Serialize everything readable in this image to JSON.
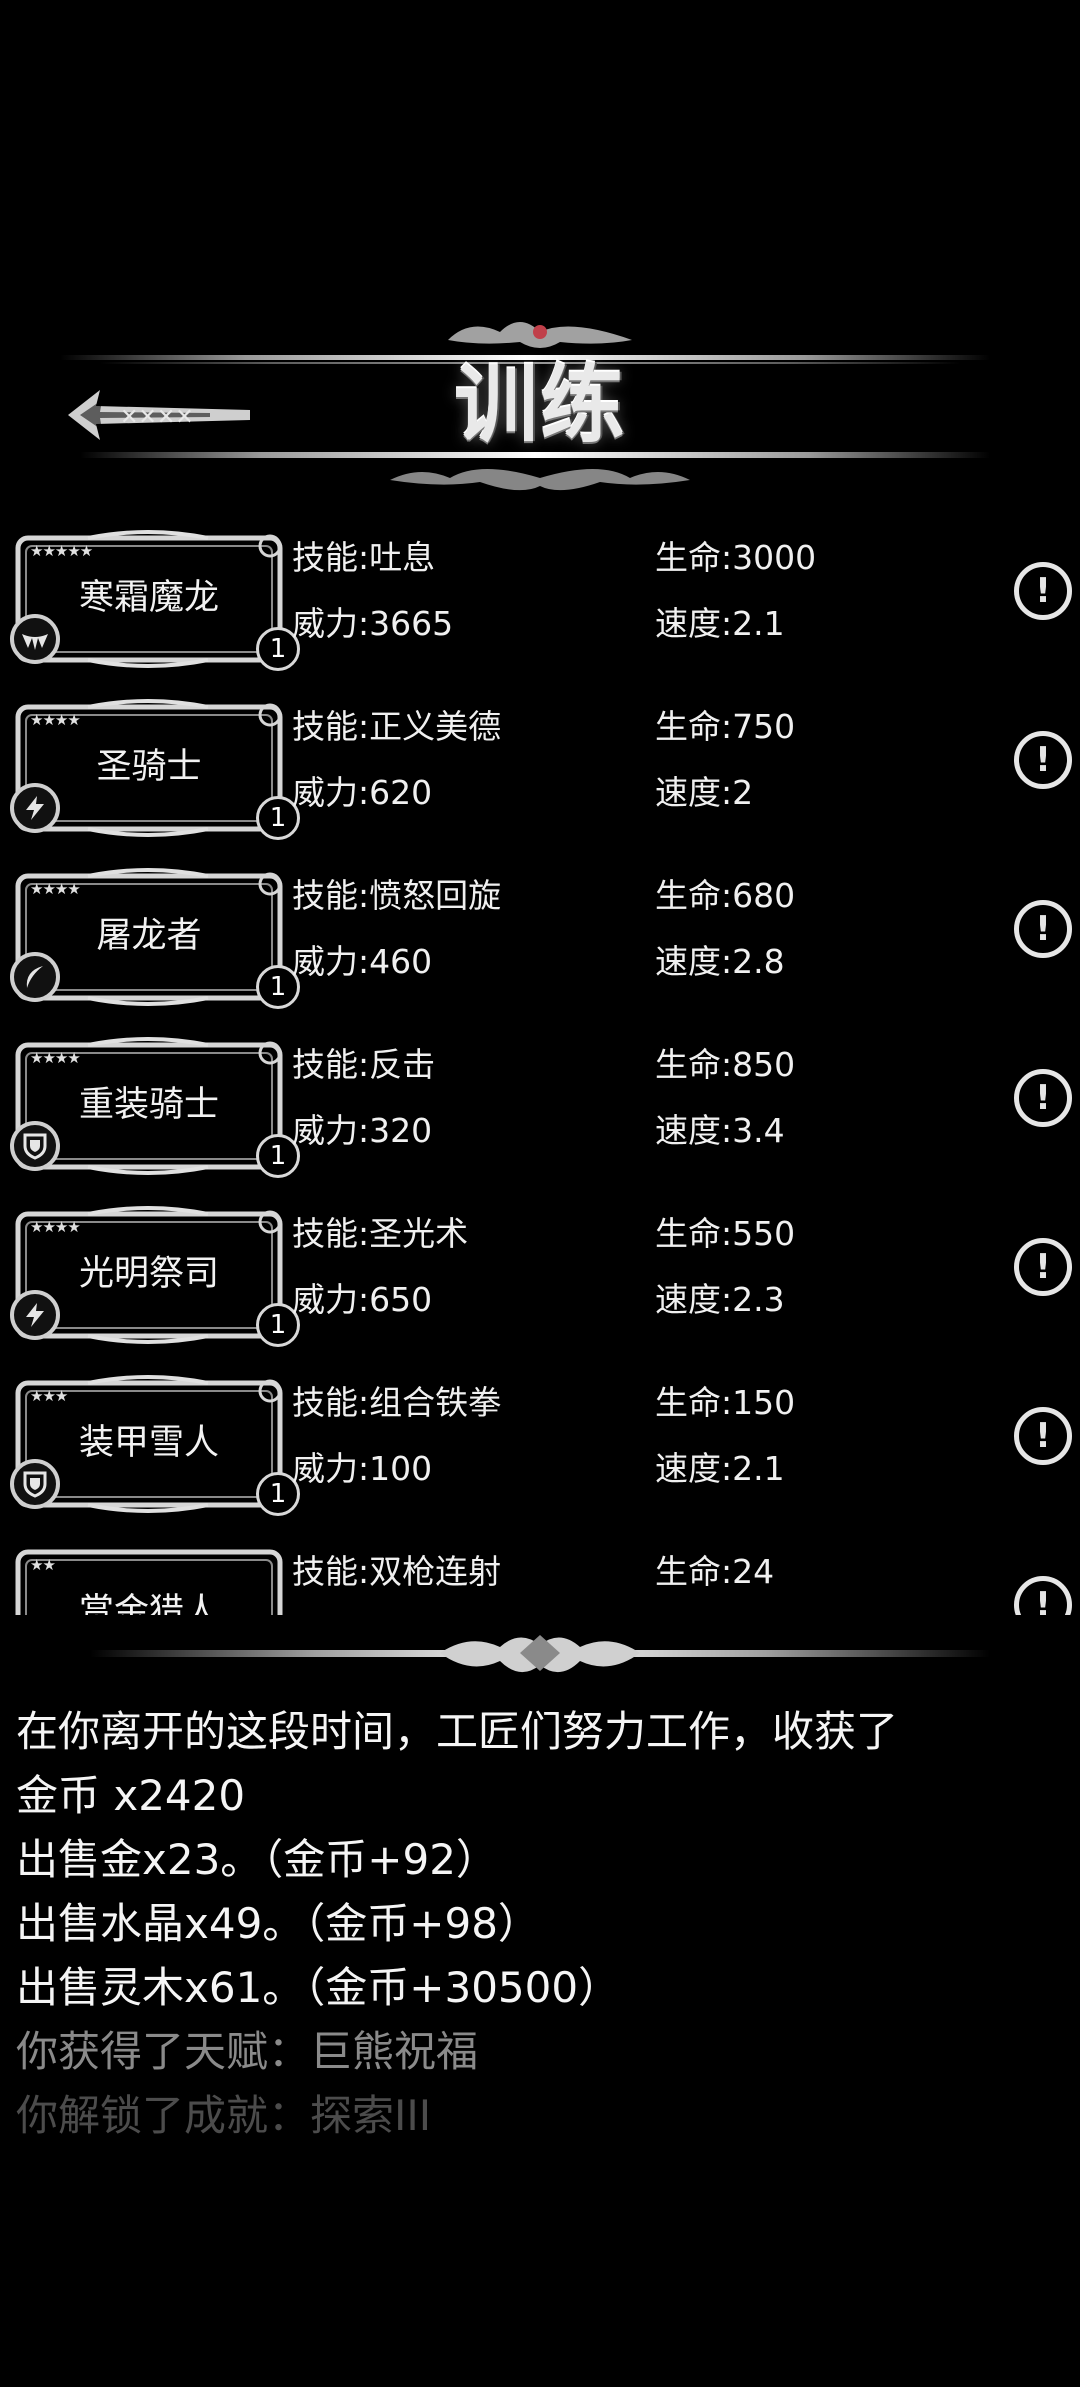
{
  "header": {
    "title": "训练",
    "back_icon": "ornate-back-arrow-icon"
  },
  "heroes": [
    {
      "stars": "★★★★★",
      "name": "寒霜魔龙",
      "class_icon": "dragon-wing-icon",
      "level": "1",
      "skill": "技能:吐息",
      "power": "威力:3665",
      "hp": "生命:3000",
      "speed": "速度:2.1"
    },
    {
      "stars": "★★★★",
      "name": "圣骑士",
      "class_icon": "lightning-icon",
      "level": "1",
      "skill": "技能:正义美德",
      "power": "威力:620",
      "hp": "生命:750",
      "speed": "速度:2"
    },
    {
      "stars": "★★★★",
      "name": "屠龙者",
      "class_icon": "crescent-blade-icon",
      "level": "1",
      "skill": "技能:愤怒回旋",
      "power": "威力:460",
      "hp": "生命:680",
      "speed": "速度:2.8"
    },
    {
      "stars": "★★★★",
      "name": "重装骑士",
      "class_icon": "shield-icon",
      "level": "1",
      "skill": "技能:反击",
      "power": "威力:320",
      "hp": "生命:850",
      "speed": "速度:3.4"
    },
    {
      "stars": "★★★★",
      "name": "光明祭司",
      "class_icon": "lightning-icon",
      "level": "1",
      "skill": "技能:圣光术",
      "power": "威力:650",
      "hp": "生命:550",
      "speed": "速度:2.3"
    },
    {
      "stars": "★★★",
      "name": "装甲雪人",
      "class_icon": "shield-icon",
      "level": "1",
      "skill": "技能:组合铁拳",
      "power": "威力:100",
      "hp": "生命:150",
      "speed": "速度:2.1"
    },
    {
      "stars": "★★",
      "name": "赏金猎人",
      "class_icon": "",
      "level": "",
      "skill": "技能:双枪连射",
      "power": "",
      "hp": "生命:24",
      "speed": ""
    }
  ],
  "info_icon": "exclamation-info-icon",
  "log": [
    "在你离开的这段时间，工匠们努力工作，收获了",
    "金币 x2420",
    "出售金x23。（金币+92）",
    "出售水晶x49。（金币+98）",
    "出售灵木x61。（金币+30500）",
    "你获得了天赋：巨熊祝福",
    "你解锁了成就：探索III"
  ]
}
